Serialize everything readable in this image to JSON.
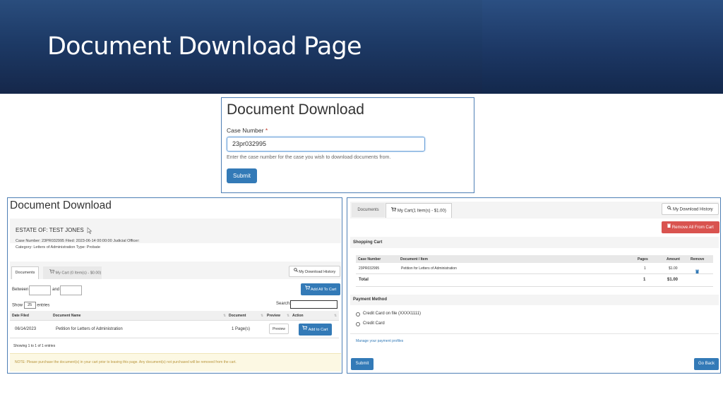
{
  "slide": {
    "title": "Document Download Page"
  },
  "panel_search": {
    "heading": "Document Download",
    "case_label": "Case Number",
    "required_mark": "*",
    "case_value": "23pr032995",
    "help_text": "Enter the case number for the case you wish to download documents from.",
    "submit_label": "Submit"
  },
  "panel_documents": {
    "heading": "Document Download",
    "estate": "ESTATE OF: TEST JONES",
    "case_line": "Case Number: 23PR032995   Filed: 2023-06-14 00:00:00   Judicial Officer:",
    "category_line": "Category: Letters of Administration   Type: Probate",
    "tab_documents": "Documents",
    "tab_cart": "My Cart (0 Item(s) - $0.00)",
    "history_label": "My Download History",
    "between_label": "Between",
    "and_label": "and",
    "add_all_label": "Add All To Cart",
    "show_label": "Show",
    "show_value": "25",
    "entries_label": "entries",
    "search_label": "Search:",
    "columns": [
      "Date Filed",
      "Document Name",
      "Document",
      "Preview",
      "Action"
    ],
    "rows": [
      {
        "date": "06/14/2023",
        "name": "Petition for Letters of Administration",
        "pages": "1 Page(s)",
        "preview": "Preview",
        "action": "Add to Cart"
      }
    ],
    "showing_text": "Showing 1 to 1 of 1 entries",
    "note_text": "NOTE: Please purchase the document(s) in your cart prior to leaving this page. Any document(s) not purchased will be removed from the cart."
  },
  "panel_cart": {
    "tab_documents": "Documents",
    "tab_cart": "My Cart(1 Item(s) - $1.00)",
    "history_label": "My Download History",
    "remove_all_label": "Remove All From Cart",
    "cart_heading": "Shopping Cart",
    "columns": [
      "Case Number",
      "Document / Item",
      "Pages",
      "Amount",
      "Remove"
    ],
    "rows": [
      {
        "case": "23PR032995",
        "item": "Petition for Letters of Administration",
        "pages": "1",
        "amount": "$1.00"
      }
    ],
    "total_label": "Total",
    "total_pages": "1",
    "total_amount": "$1.00",
    "payment_heading": "Payment Method",
    "payment_options": [
      "Credit Card on file (XXXX1111)",
      "Credit Card"
    ],
    "manage_link": "Manage your payment profiles",
    "submit_label": "Submit",
    "goback_label": "Go Back"
  },
  "colors": {
    "primary": "#337ab7",
    "danger": "#d9534f",
    "banner": "#1d3a66",
    "note_bg": "#fcf8e3"
  }
}
